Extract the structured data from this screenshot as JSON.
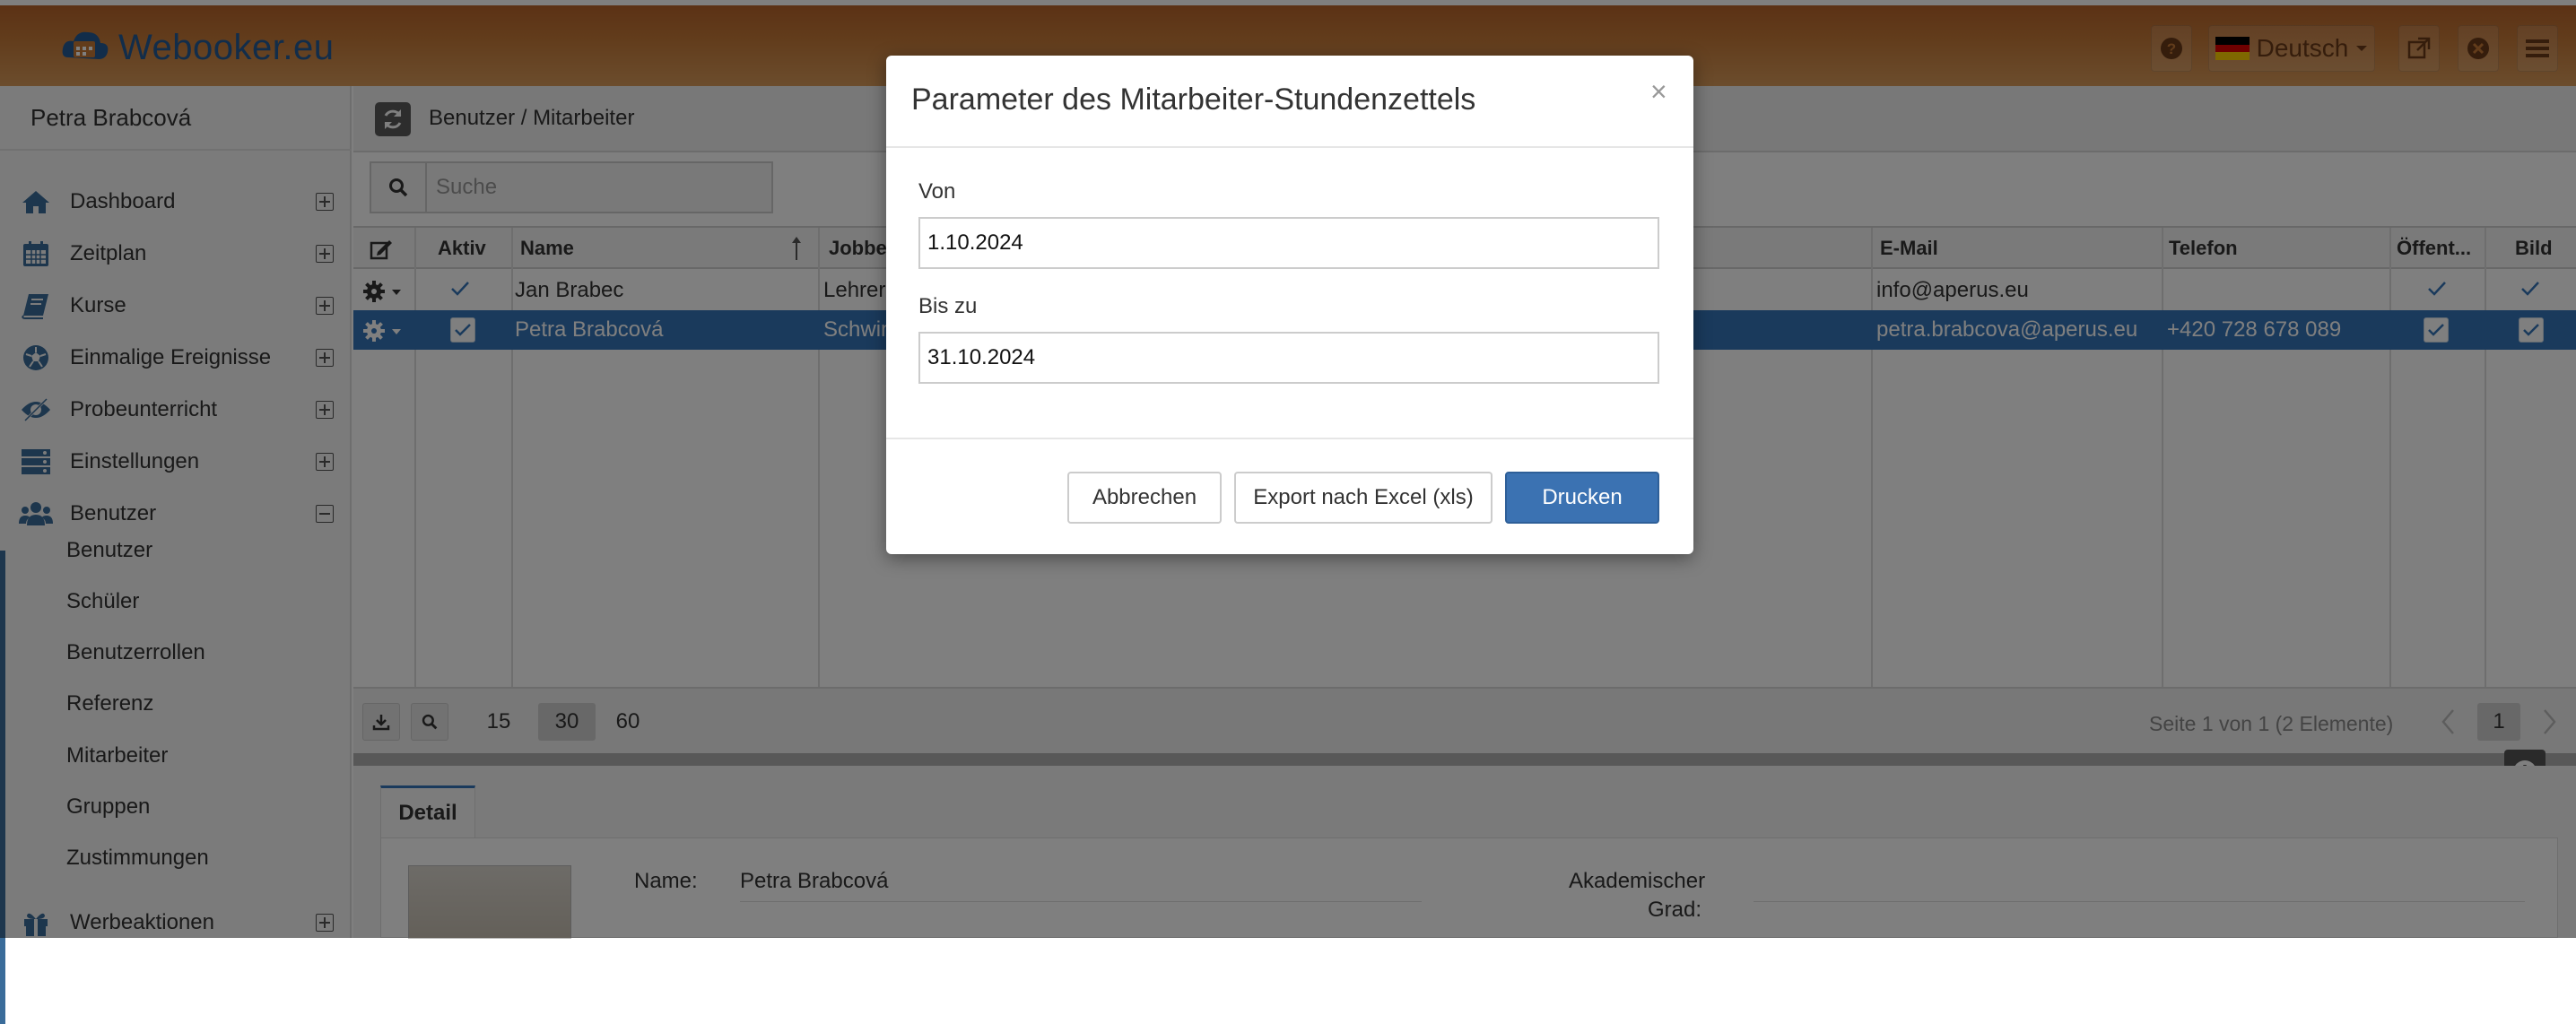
{
  "header": {
    "logo_text": "Webooker.eu",
    "language": "Deutsch"
  },
  "sidebar": {
    "user_name": "Petra Brabcová",
    "menu": [
      {
        "label": "Dashboard",
        "icon": "home-icon"
      },
      {
        "label": "Zeitplan",
        "icon": "calendar-icon"
      },
      {
        "label": "Kurse",
        "icon": "book-icon"
      },
      {
        "label": "Einmalige Ereignisse",
        "icon": "soccer-ball-icon"
      },
      {
        "label": "Probeunterricht",
        "icon": "eye-icon"
      },
      {
        "label": "Einstellungen",
        "icon": "server-icon"
      },
      {
        "label": "Benutzer",
        "icon": "users-icon"
      },
      {
        "label": "Werbeaktionen",
        "icon": "gift-icon"
      }
    ],
    "submenu": [
      "Benutzer",
      "Schüler",
      "Benutzerrollen",
      "Referenz",
      "Mitarbeiter",
      "Gruppen",
      "Zustimmungen"
    ]
  },
  "main": {
    "breadcrumb": "Benutzer / Mitarbeiter",
    "search_placeholder": "Suche",
    "columns": [
      "Aktiv",
      "Name",
      "Jobbes",
      "E-Mail",
      "Telefon",
      "Öffent...",
      "Bild"
    ],
    "rows": [
      {
        "name": "Jan Brabec",
        "job": "Lehrer",
        "email": "info@aperus.eu",
        "phone": "",
        "selected": false
      },
      {
        "name": "Petra Brabcová",
        "job": "Schwin",
        "email": "petra.brabcova@aperus.eu",
        "phone": "+420 728 678 089",
        "selected": true
      }
    ],
    "pager": {
      "sizes": [
        "15",
        "30",
        "60"
      ],
      "selected_size": "30",
      "info": "Seite 1 von 1 (2 Elemente)",
      "page": "1"
    },
    "detail": {
      "tab": "Detail",
      "name_label": "Name:",
      "name_value": "Petra Brabcová",
      "title_label_1": "Akademischer",
      "title_label_2": "Grad:"
    }
  },
  "modal": {
    "title": "Parameter des Mitarbeiter-Stundenzettels",
    "close": "×",
    "from_label": "Von",
    "from_value": "1.10.2024",
    "to_label": "Bis zu",
    "to_value": "31.10.2024",
    "cancel_label": "Abbrechen",
    "export_label": "Export nach Excel (xls)",
    "print_label": "Drucken"
  },
  "colors": {
    "header_brown": "#c47837",
    "logo_blue": "#245a94",
    "selection_blue": "#3574b8",
    "primary_button": "#3b72b2"
  }
}
